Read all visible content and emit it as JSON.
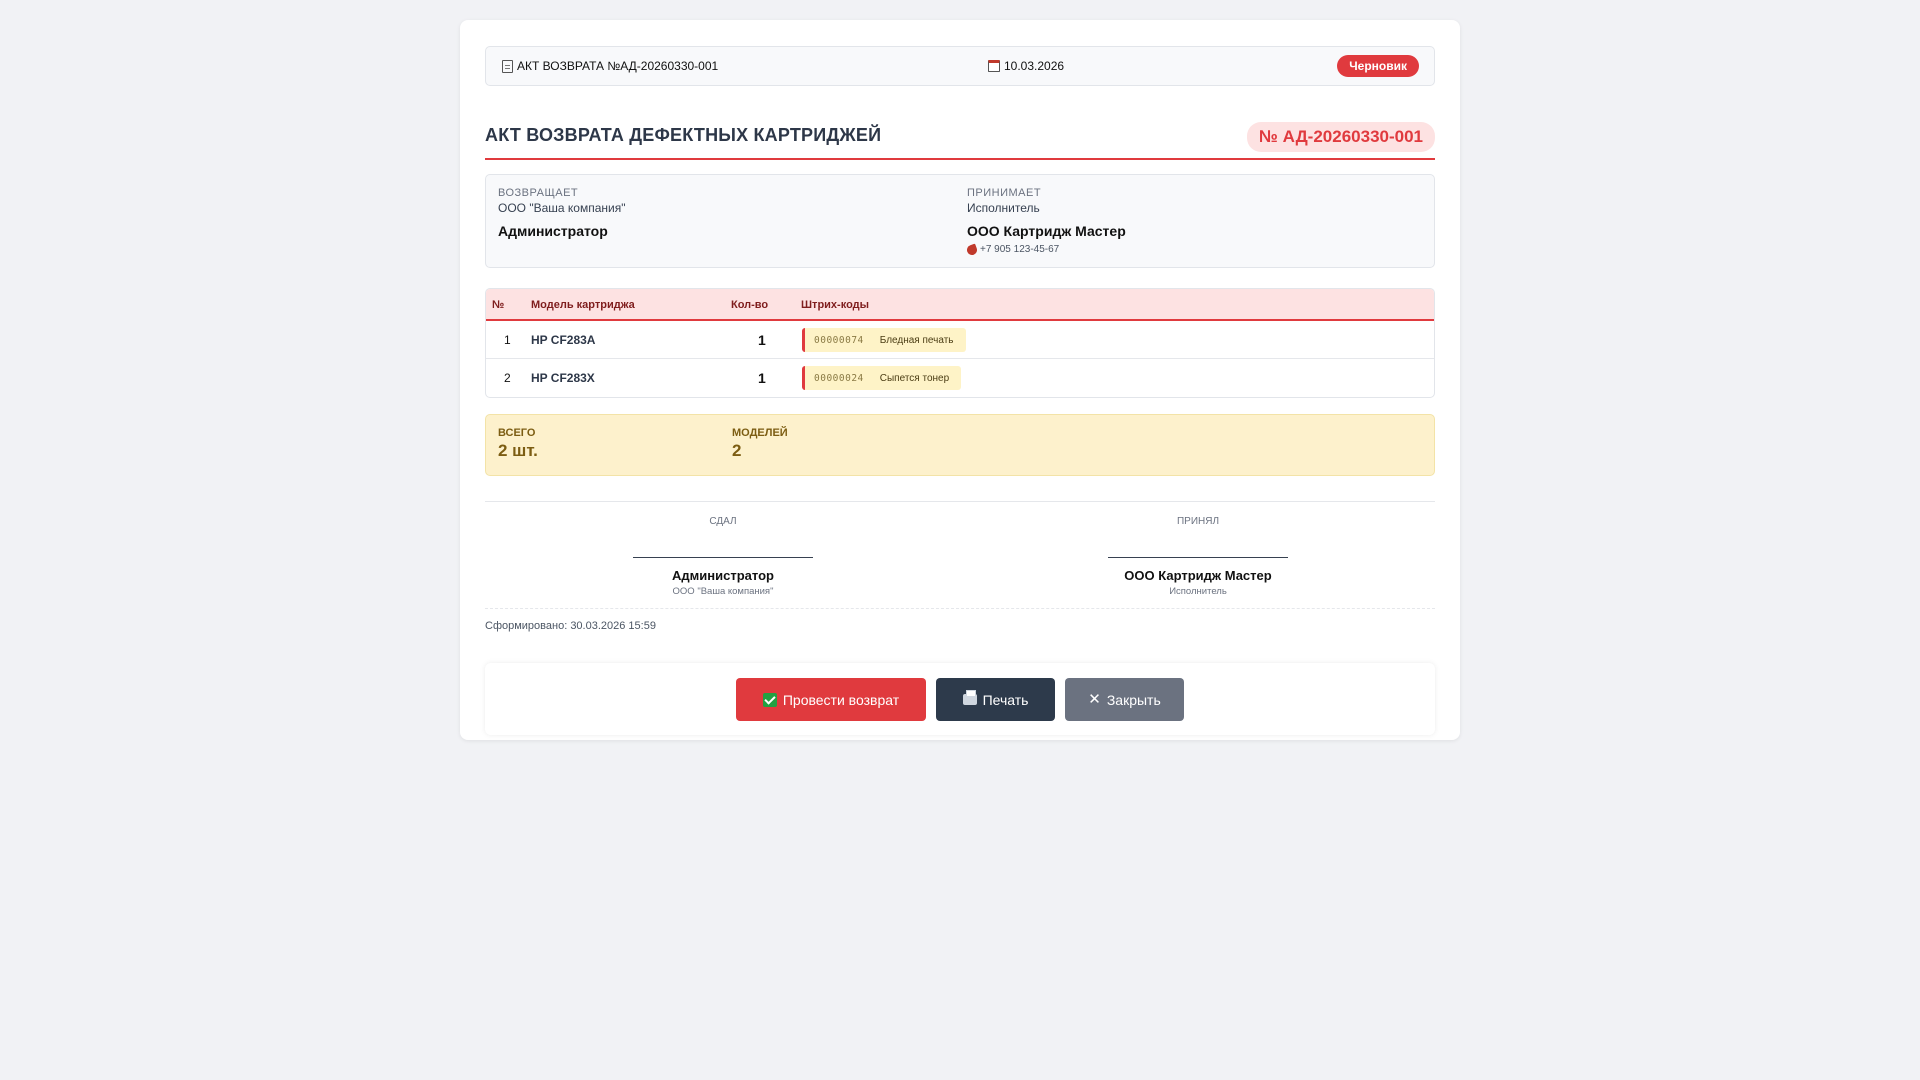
{
  "header": {
    "doc_label": "АКТ ВОЗВРАТА №АД-20260330-001",
    "date": "10.03.2026",
    "status": "Черновик"
  },
  "title": "АКТ ВОЗВРАТА ДЕФЕКТНЫХ КАРТРИДЖЕЙ",
  "number": "№ АД-20260330-001",
  "parties": {
    "sender": {
      "label": "ВОЗВРАЩАЕТ",
      "org": "ООО \"Ваша компания\"",
      "name": "Администратор"
    },
    "receiver": {
      "label": "ПРИНИМАЕТ",
      "org": "Исполнитель",
      "name": "ООО Картридж Мастер",
      "phone": "+7 905 123-45-67"
    }
  },
  "table": {
    "headers": [
      "№",
      "Модель картриджа",
      "Кол-во",
      "Штрих-коды"
    ],
    "rows": [
      {
        "no": "1",
        "model": "HP CF283A",
        "qty": "1",
        "barcode": "00000074",
        "defect": "Бледная печать"
      },
      {
        "no": "2",
        "model": "HP CF283X",
        "qty": "1",
        "barcode": "00000024",
        "defect": "Сыпется тонер"
      }
    ]
  },
  "totals": {
    "total_label": "ВСЕГО",
    "total_value": "2 шт.",
    "models_label": "МОДЕЛЕЙ",
    "models_value": "2"
  },
  "signatures": {
    "left": {
      "label": "СДАЛ",
      "name": "Администратор",
      "role": "ООО \"Ваша компания\""
    },
    "right": {
      "label": "ПРИНЯЛ",
      "name": "ООО Картридж Мастер",
      "role": "Исполнитель"
    }
  },
  "generated": "Сформировано: 30.03.2026 15:59",
  "actions": {
    "return_label": "Провести возврат",
    "print_label": "Печать",
    "close_label": "Закрыть"
  },
  "colors": {
    "accent": "#e03a3e",
    "dark": "#2d3a4b",
    "gray": "#6b7280",
    "totals_bg": "#fdf1cc"
  }
}
